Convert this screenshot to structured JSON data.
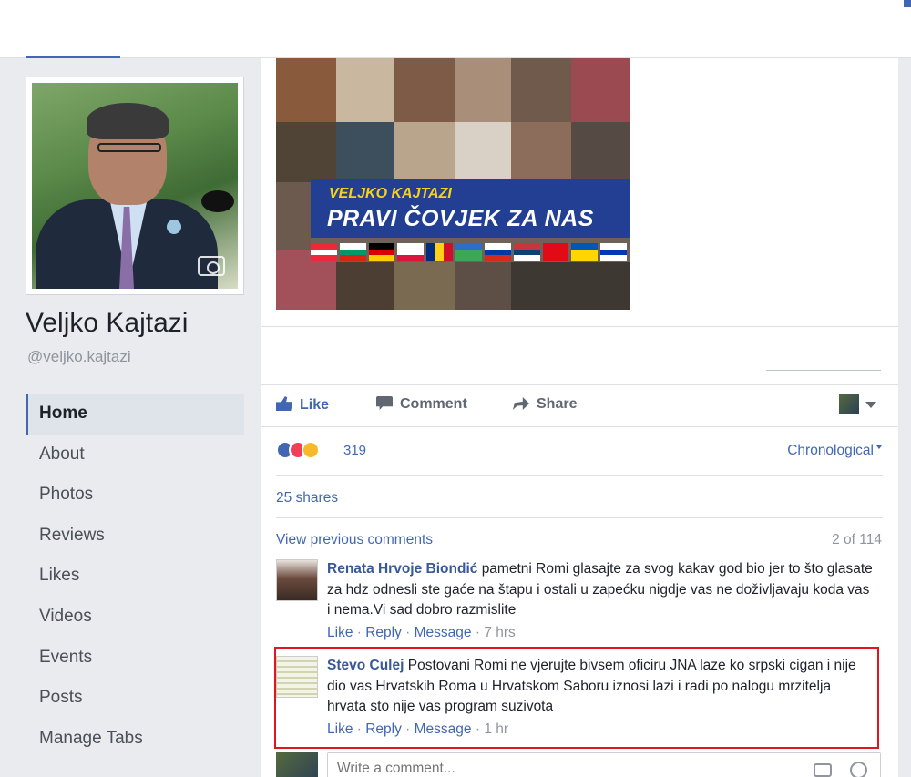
{
  "profile": {
    "name": "Veljko Kajtazi",
    "handle": "@veljko.kajtazi"
  },
  "nav": {
    "items": [
      {
        "label": "Home"
      },
      {
        "label": "About"
      },
      {
        "label": "Photos"
      },
      {
        "label": "Reviews"
      },
      {
        "label": "Likes"
      },
      {
        "label": "Videos"
      },
      {
        "label": "Events"
      },
      {
        "label": "Posts"
      },
      {
        "label": "Manage Tabs"
      }
    ]
  },
  "banner": {
    "line1": "VELJKO KAJTAZI",
    "line2": "PRAVI ČOVJEK ZA NAS"
  },
  "actions": {
    "like": "Like",
    "comment": "Comment",
    "share": "Share"
  },
  "reactions": {
    "count": "319",
    "sort_label": "Chronological"
  },
  "shares": "25 shares",
  "comments_header": {
    "view_previous": "View previous comments",
    "count_of": "2 of 114"
  },
  "comments": [
    {
      "author": "Renata Hrvoje Biondić",
      "text": "pametni Romi glasajte za svog kakav god bio jer to što glasate za hdz odnesli ste gaće na štapu i ostali u zapećku nigdje vas ne doživljavaju koda vas i nema.Vi sad dobro razmislite",
      "like": "Like",
      "reply": "Reply",
      "message": "Message",
      "time": "7 hrs"
    },
    {
      "author": "Stevo Culej",
      "text": "Postovani Romi ne vjerujte bivsem oficiru JNA laze ko srpski cigan i nije dio vas Hrvatskih Roma u Hrvatskom Saboru iznosi lazi i radi po nalogu mrzitelja hrvata sto nije vas program suzivota",
      "like": "Like",
      "reply": "Reply",
      "message": "Message",
      "time": "1 hr"
    }
  ],
  "write_comment": {
    "placeholder": "Write a comment..."
  },
  "colors": {
    "brand": "#4267b2",
    "highlight": "#e0161d",
    "banner_blue": "#233f94",
    "banner_yellow": "#f6d21b"
  }
}
